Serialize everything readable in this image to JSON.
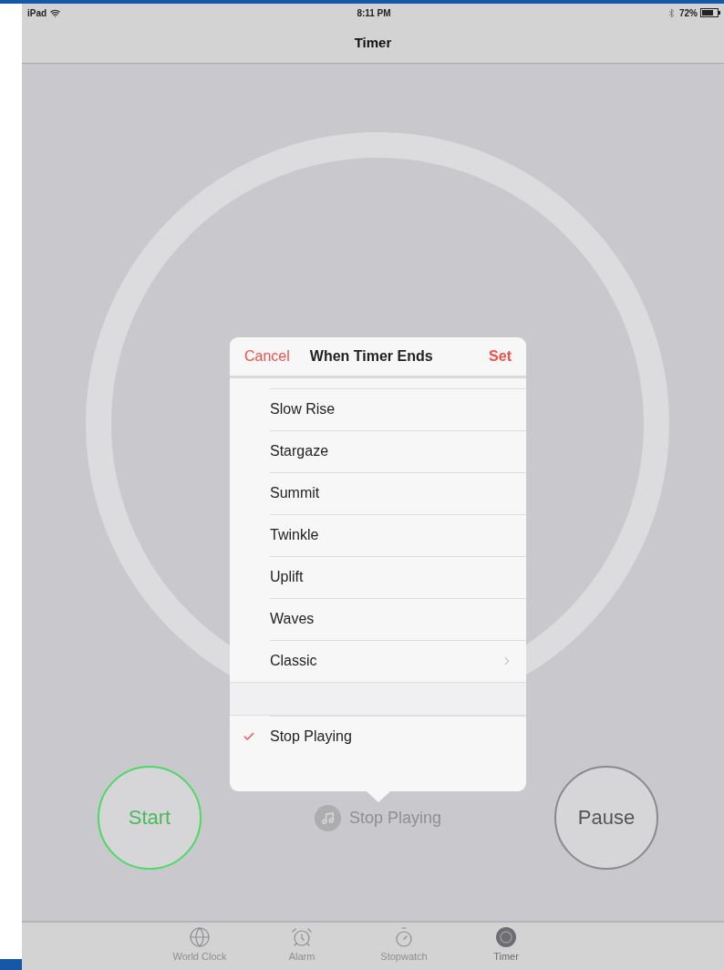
{
  "status_bar": {
    "device": "iPad",
    "time": "8:11 PM",
    "battery": "72%"
  },
  "nav_bar": {
    "title": "Timer"
  },
  "popover": {
    "cancel": "Cancel",
    "title": "When Timer Ends",
    "set": "Set",
    "sounds": [
      {
        "label": "Slow Rise",
        "checked": false,
        "disclosure": false
      },
      {
        "label": "Stargaze",
        "checked": false,
        "disclosure": false
      },
      {
        "label": "Summit",
        "checked": false,
        "disclosure": false
      },
      {
        "label": "Twinkle",
        "checked": false,
        "disclosure": false
      },
      {
        "label": "Uplift",
        "checked": false,
        "disclosure": false
      },
      {
        "label": "Waves",
        "checked": false,
        "disclosure": false
      },
      {
        "label": "Classic",
        "checked": false,
        "disclosure": true
      }
    ],
    "stop_option": {
      "label": "Stop Playing",
      "checked": true
    }
  },
  "controls": {
    "start": "Start",
    "sound_label": "Stop Playing",
    "pause": "Pause"
  },
  "tab_bar": [
    {
      "kind": "globe",
      "label": "World Clock",
      "selected": false
    },
    {
      "kind": "alarm",
      "label": "Alarm",
      "selected": false
    },
    {
      "kind": "stopwatch",
      "label": "Stopwatch",
      "selected": false
    },
    {
      "kind": "timer",
      "label": "Timer",
      "selected": true
    }
  ]
}
